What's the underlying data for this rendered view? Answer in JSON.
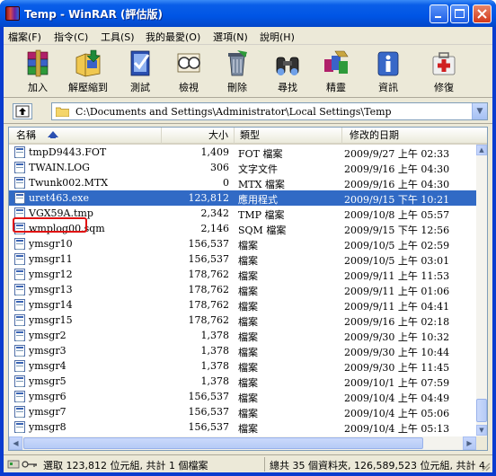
{
  "window": {
    "title": "Temp - WinRAR (評估版)"
  },
  "menu": [
    {
      "label": "檔案(F)"
    },
    {
      "label": "指令(C)"
    },
    {
      "label": "工具(S)"
    },
    {
      "label": "我的最愛(O)"
    },
    {
      "label": "選項(N)"
    },
    {
      "label": "說明(H)"
    }
  ],
  "toolbar": [
    {
      "label": "加入",
      "icon": "add-archive-icon"
    },
    {
      "label": "解壓縮到",
      "icon": "extract-to-icon"
    },
    {
      "label": "測試",
      "icon": "test-icon"
    },
    {
      "label": "檢視",
      "icon": "view-icon"
    },
    {
      "label": "刪除",
      "icon": "delete-icon"
    },
    {
      "label": "尋找",
      "icon": "find-icon"
    },
    {
      "label": "精靈",
      "icon": "wizard-icon"
    },
    {
      "label": "資訊",
      "icon": "info-icon"
    },
    {
      "label": "修復",
      "icon": "repair-icon"
    }
  ],
  "address": {
    "path": "C:\\Documents and Settings\\Administrator\\Local Settings\\Temp"
  },
  "columns": {
    "name": "名稱",
    "size": "大小",
    "type": "類型",
    "modified": "修改的日期"
  },
  "files": [
    {
      "name": "tmpD9443.FOT",
      "size": "1,409",
      "type": "FOT 檔案",
      "date": "2009/9/27 上午 02:33"
    },
    {
      "name": "TWAIN.LOG",
      "size": "306",
      "type": "文字文件",
      "date": "2009/9/16 上午 04:30"
    },
    {
      "name": "Twunk002.MTX",
      "size": "0",
      "type": "MTX 檔案",
      "date": "2009/9/16 上午 04:30"
    },
    {
      "name": "uret463.exe",
      "size": "123,812",
      "type": "應用程式",
      "date": "2009/9/15 下午 10:21"
    },
    {
      "name": "VGX59A.tmp",
      "size": "2,342",
      "type": "TMP 檔案",
      "date": "2009/10/8 上午 05:57"
    },
    {
      "name": "wmplog00.sqm",
      "size": "2,146",
      "type": "SQM 檔案",
      "date": "2009/9/15 下午 12:56"
    },
    {
      "name": "ymsgr10",
      "size": "156,537",
      "type": "檔案",
      "date": "2009/10/5 上午 02:59"
    },
    {
      "name": "ymsgr11",
      "size": "156,537",
      "type": "檔案",
      "date": "2009/10/5 上午 03:01"
    },
    {
      "name": "ymsgr12",
      "size": "178,762",
      "type": "檔案",
      "date": "2009/9/11 上午 11:53"
    },
    {
      "name": "ymsgr13",
      "size": "178,762",
      "type": "檔案",
      "date": "2009/9/11 上午 01:06"
    },
    {
      "name": "ymsgr14",
      "size": "178,762",
      "type": "檔案",
      "date": "2009/9/11 上午 04:41"
    },
    {
      "name": "ymsgr15",
      "size": "178,762",
      "type": "檔案",
      "date": "2009/9/16 上午 02:18"
    },
    {
      "name": "ymsgr2",
      "size": "1,378",
      "type": "檔案",
      "date": "2009/9/30 上午 10:32"
    },
    {
      "name": "ymsgr3",
      "size": "1,378",
      "type": "檔案",
      "date": "2009/9/30 上午 10:44"
    },
    {
      "name": "ymsgr4",
      "size": "1,378",
      "type": "檔案",
      "date": "2009/9/30 上午 11:45"
    },
    {
      "name": "ymsgr5",
      "size": "1,378",
      "type": "檔案",
      "date": "2009/10/1 上午 07:59"
    },
    {
      "name": "ymsgr6",
      "size": "156,537",
      "type": "檔案",
      "date": "2009/10/4 上午 04:49"
    },
    {
      "name": "ymsgr7",
      "size": "156,537",
      "type": "檔案",
      "date": "2009/10/4 上午 05:06"
    },
    {
      "name": "ymsgr8",
      "size": "156,537",
      "type": "檔案",
      "date": "2009/10/4 上午 05:13"
    }
  ],
  "selected_file": "uret463.exe",
  "status": {
    "left": "選取 123,812 位元組, 共計 1 個檔案",
    "right": "總共 35 個資料夾, 126,589,523 位元組, 共計 4"
  },
  "colors": {
    "title_blue": "#0055e5",
    "selection": "#316ac5",
    "highlight_box": "#e01010"
  }
}
